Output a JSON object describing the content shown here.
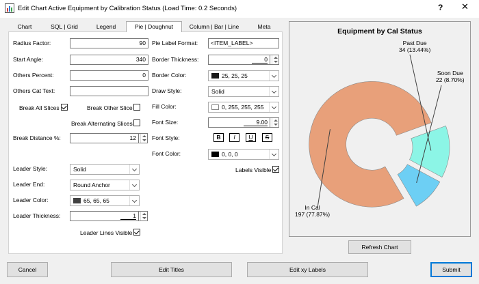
{
  "window": {
    "title": "Edit Chart Active Equipment by Calibration Status (Load Time: 0.2 Seconds)",
    "help": "?",
    "close": "✕"
  },
  "tabs": [
    "Chart",
    "SQL | Grid",
    "Legend",
    "Pie | Doughnut",
    "Column | Bar | Line",
    "Meta"
  ],
  "active_tab": "Pie | Doughnut",
  "pie": {
    "radius_factor_label": "Radius Factor:",
    "radius_factor": "90",
    "start_angle_label": "Start Angle:",
    "start_angle": "340",
    "others_percent_label": "Others Percent:",
    "others_percent": "0",
    "others_cat_text_label": "Others Cat Text:",
    "others_cat_text": "",
    "break_all_slices_label": "Break All Slices",
    "break_all_slices": true,
    "break_other_slice_label": "Break Other Slice",
    "break_other_slice": false,
    "break_alternating_label": "Break Alternating Slices",
    "break_alternating": false,
    "break_distance_label": "Break Distance %:",
    "break_distance": "12",
    "leader_style_label": "Leader Style:",
    "leader_style": "Solid",
    "leader_end_label": "Leader End:",
    "leader_end": "Round Anchor",
    "leader_color_label": "Leader Color:",
    "leader_color": "65, 65, 65",
    "leader_color_hex": "#414141",
    "leader_thickness_label": "Leader Thickness:",
    "leader_thickness": "1",
    "leader_lines_visible_label": "Leader Lines Visible",
    "leader_lines_visible": true,
    "label_format_label": "Pie Label Format:",
    "label_format": "<ITEM_LABEL>",
    "border_thickness_label": "Border Thickness:",
    "border_thickness": "0",
    "border_color_label": "Border Color:",
    "border_color": "25, 25, 25",
    "border_color_hex": "#191919",
    "draw_style_label": "Draw Style:",
    "draw_style": "Solid",
    "fill_color_label": "Fill Color:",
    "fill_color": "0, 255, 255, 255",
    "fill_color_hex": "#ffffff",
    "font_size_label": "Font Size:",
    "font_size": "9.00",
    "font_style_label": "Font Style:",
    "font_style_buttons": [
      "B",
      "I",
      "U",
      "S"
    ],
    "font_color_label": "Font Color:",
    "font_color": "0, 0, 0",
    "font_color_hex": "#000000",
    "labels_visible_label": "Labels Visible",
    "labels_visible": true
  },
  "chart": {
    "title": "Equipment by Cal Status",
    "refresh_label": "Refresh Chart"
  },
  "chart_data": {
    "type": "pie",
    "title": "Equipment by Cal Status",
    "categories": [
      "Past Due",
      "Soon Due",
      "In Cal"
    ],
    "values": [
      34,
      22,
      197
    ],
    "percent_labels": [
      "34 (13.44%)",
      "22 (8.70%)",
      "197 (77.87%)"
    ],
    "colors": [
      "#8cf5e6",
      "#6dcff4",
      "#e8a07a"
    ],
    "doughnut": true,
    "exploded": true,
    "start_angle": 340
  },
  "buttons": {
    "cancel": "Cancel",
    "edit_titles": "Edit Titles",
    "edit_xy_labels": "Edit xy Labels",
    "submit": "Submit"
  }
}
